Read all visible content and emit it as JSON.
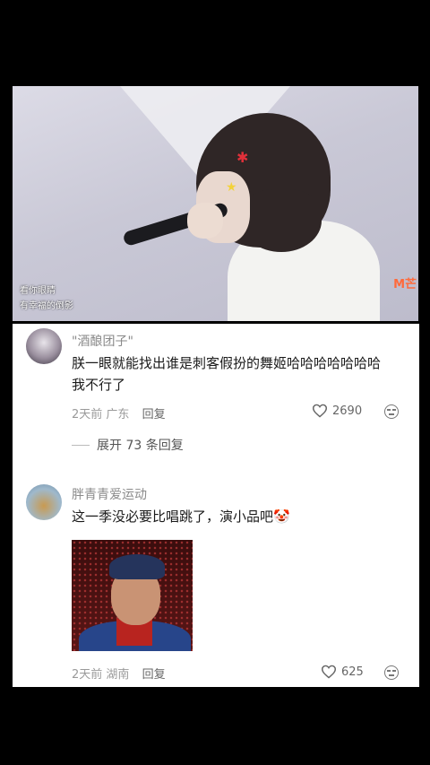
{
  "video": {
    "caption_line1": "看你眼睛",
    "caption_line2": "有幸福的倒影",
    "logo_text": "M芒"
  },
  "comments": [
    {
      "username": "\"酒酿团子\"",
      "text_line1": "朕一眼就能找出谁是刺客假扮的舞姬哈哈哈哈哈哈哈",
      "text_line2": "我不行了",
      "time": "2天前",
      "location": "广东",
      "reply_label": "回复",
      "likes": "2690",
      "expand_label": "展开 73 条回复"
    },
    {
      "username": "胖青青爱运动",
      "text": "这一季没必要比唱跳了，演小品吧🤡",
      "time": "2天前",
      "location": "湖南",
      "reply_label": "回复",
      "likes": "625"
    }
  ],
  "icons": {
    "like": "heart-outline-icon",
    "dislike": "meh-face-icon"
  },
  "colors": {
    "background": "#000000",
    "panel": "#ffffff",
    "meta_text": "#9a9a9a"
  }
}
